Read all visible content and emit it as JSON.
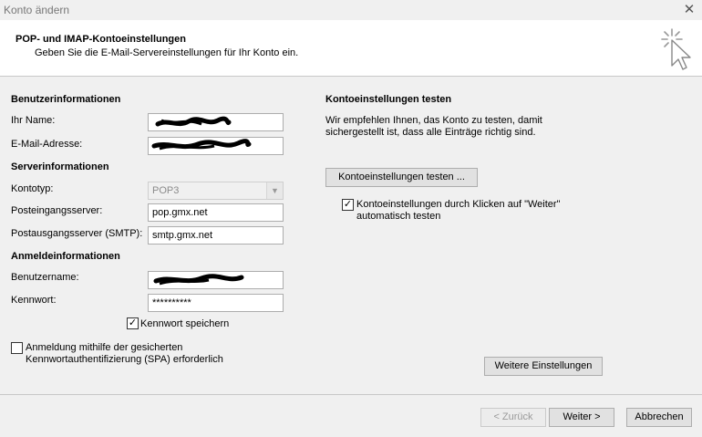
{
  "window": {
    "title": "Konto ändern",
    "close_glyph": "✕"
  },
  "header": {
    "title": "POP- und IMAP-Kontoeinstellungen",
    "subtitle": "Geben Sie die E-Mail-Servereinstellungen für Ihr Konto ein."
  },
  "user_info": {
    "section": "Benutzerinformationen",
    "name_label": "Ihr Name:",
    "name_value": "",
    "email_label": "E-Mail-Adresse:",
    "email_value": ""
  },
  "server_info": {
    "section": "Serverinformationen",
    "type_label": "Kontotyp:",
    "type_value": "POP3",
    "incoming_label": "Posteingangsserver:",
    "incoming_value": "pop.gmx.net",
    "outgoing_label": "Postausgangsserver (SMTP):",
    "outgoing_value": "smtp.gmx.net"
  },
  "login_info": {
    "section": "Anmeldeinformationen",
    "username_label": "Benutzername:",
    "username_value": "",
    "password_label": "Kennwort:",
    "password_value": "**********",
    "remember_label": "Kennwort speichern",
    "remember_checked": true,
    "spa_label_line1": "Anmeldung mithilfe der gesicherten",
    "spa_label_line2": "Kennwortauthentifizierung (SPA) erforderlich",
    "spa_checked": false
  },
  "test_settings": {
    "section": "Kontoeinstellungen testen",
    "desc_line1": "Wir empfehlen Ihnen, das Konto zu testen, damit",
    "desc_line2": "sichergestellt ist, dass alle Einträge richtig sind.",
    "test_button": "Kontoeinstellungen testen ...",
    "auto_test_line1": "Kontoeinstellungen durch Klicken auf \"Weiter\"",
    "auto_test_line2": "automatisch testen",
    "auto_test_checked": true
  },
  "buttons": {
    "more_settings": "Weitere Einstellungen",
    "back": "< Zurück",
    "next": "Weiter >",
    "cancel": "Abbrechen"
  },
  "checkmark_glyph": "✓",
  "colors": {
    "header_bg": "#ffffff",
    "dialog_bg": "#f0f0f0",
    "field_border": "#adadad"
  }
}
